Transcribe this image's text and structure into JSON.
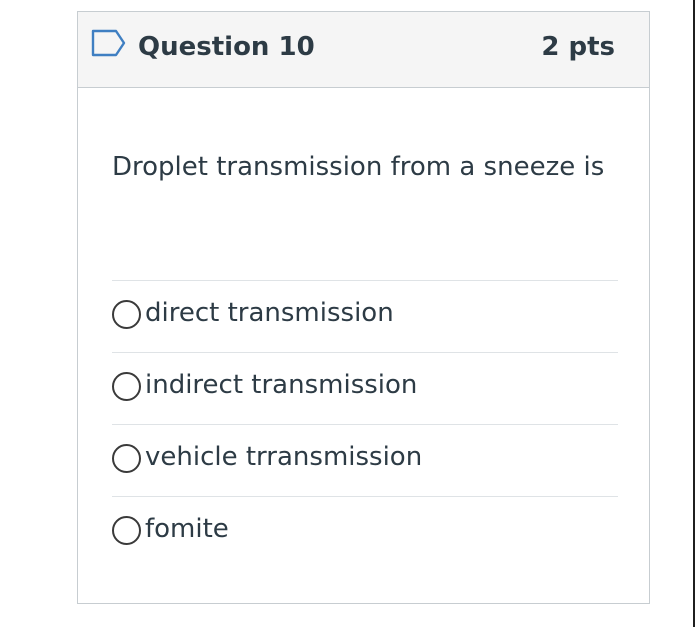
{
  "question": {
    "title": "Question 10",
    "points": "2 pts",
    "text": "Droplet transmission from a sneeze is",
    "flag_icon": "flag-outline-icon",
    "answers": [
      {
        "label": "direct transmission"
      },
      {
        "label": "indirect transmission"
      },
      {
        "label": "vehicle trransmission"
      },
      {
        "label": "fomite"
      }
    ]
  },
  "colors": {
    "text": "#2d3b45",
    "header_bg": "#f5f5f5",
    "border": "#c7cdd1",
    "flag": "#3f7fc2"
  }
}
